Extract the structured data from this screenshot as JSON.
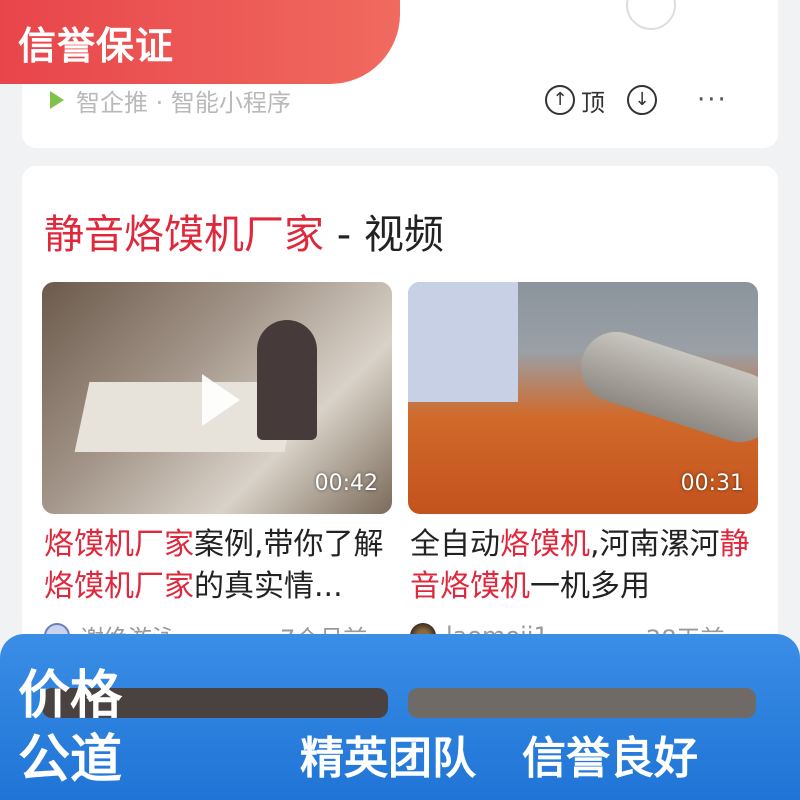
{
  "banner_top": "信誉保证",
  "top_card": {
    "source_text": "智企推 · 智能小程序",
    "top_label": "顶"
  },
  "section": {
    "title_highlight": "静音烙馍机厂家",
    "title_rest": " - 视频"
  },
  "videos": [
    {
      "duration": "00:42",
      "title_parts": [
        {
          "text": "烙馍机厂家",
          "red": true
        },
        {
          "text": "案例,带你了解",
          "red": false
        },
        {
          "text": "烙馍机厂家",
          "red": true
        },
        {
          "text": "的真实情...",
          "red": false
        }
      ],
      "author": "谢绝游泳...",
      "time": "7个月前"
    },
    {
      "duration": "00:31",
      "title_parts": [
        {
          "text": "全自动",
          "red": false
        },
        {
          "text": "烙馍机",
          "red": true
        },
        {
          "text": ",河南漯河",
          "red": false
        },
        {
          "text": "静音烙馍机",
          "red": true
        },
        {
          "text": "一机多用",
          "red": false
        }
      ],
      "author": "laomoji1...",
      "time": "28天前"
    }
  ],
  "bottom": {
    "price_badge": "价格公道",
    "slogans": [
      "精英团队",
      "信誉良好"
    ]
  },
  "colors": {
    "highlight_red": "#e0283c",
    "banner_red": "#e8454a",
    "band_blue": "#2a82e0"
  }
}
